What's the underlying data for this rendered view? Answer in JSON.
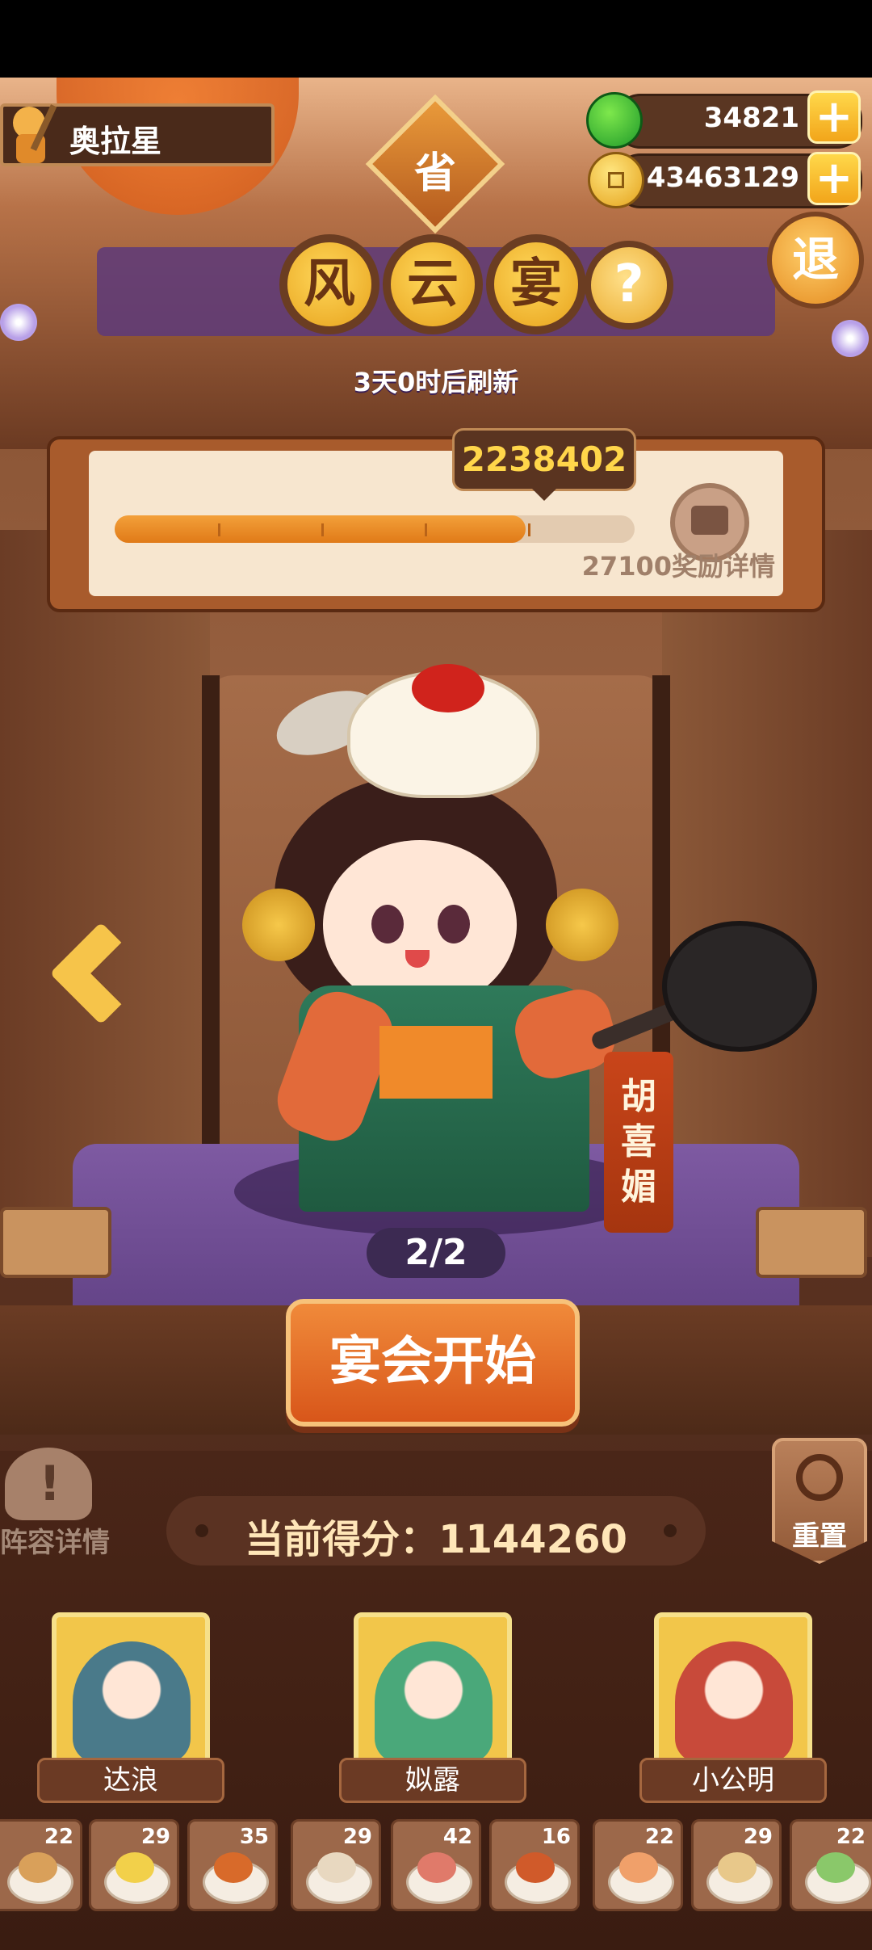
{
  "player": {
    "name": "奥拉星"
  },
  "resources": {
    "jade": "34821",
    "coins": "43463129",
    "plus": "+"
  },
  "province_badge": "省",
  "title_chars": [
    "风",
    "云",
    "宴"
  ],
  "help_symbol": "?",
  "exit_label": "退",
  "refresh_text": "3天0时后刷新",
  "progress": {
    "score": "2238402",
    "fill_fraction": 0.79,
    "reward_label": "27100奖励详情"
  },
  "character": {
    "name_chars": [
      "胡",
      "喜",
      "媚"
    ]
  },
  "page_indicator": "2/2",
  "start_button": "宴会开始",
  "lineup_label": "阵容详情",
  "reset_label": "重置",
  "current_score": "当前得分：1144260",
  "heroes": [
    {
      "name": "达浪",
      "color": "#4a7a8a"
    },
    {
      "name": "姒露",
      "color": "#4aa87a"
    },
    {
      "name": "小公明",
      "color": "#c84a3a"
    }
  ],
  "dishes": [
    {
      "count": "22",
      "color": "#d9a05a"
    },
    {
      "count": "29",
      "color": "#f2d04a"
    },
    {
      "count": "35",
      "color": "#d86a2a"
    },
    {
      "count": "29",
      "color": "#e8d8c0"
    },
    {
      "count": "42",
      "color": "#e07a6a"
    },
    {
      "count": "16",
      "color": "#d05a2a"
    },
    {
      "count": "22",
      "color": "#f0a06a"
    },
    {
      "count": "29",
      "color": "#e8c88a"
    },
    {
      "count": "22",
      "color": "#8ac86a"
    }
  ]
}
